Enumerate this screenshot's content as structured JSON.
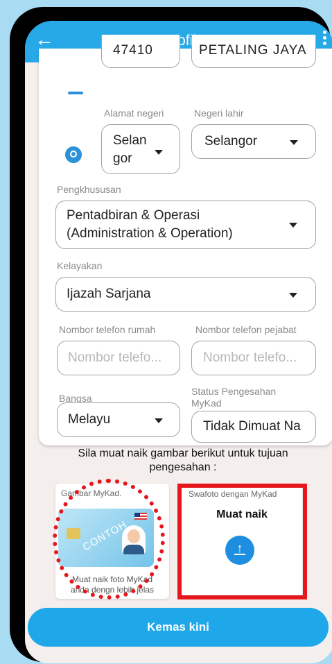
{
  "appbar": {
    "title": "Profil"
  },
  "fields": {
    "poskod_value": "47410",
    "bandar_value": "PETALING JAYA",
    "alamat_negeri_label": "Alamat negeri",
    "alamat_negeri_value_line1": "Selan",
    "alamat_negeri_value_line2": "gor",
    "negeri_lahir_label": "Negeri lahir",
    "negeri_lahir_value": "Selangor",
    "pengkhususan_label": "Pengkhususan",
    "pengkhususan_value_line1": "Pentadbiran & Operasi",
    "pengkhususan_value_line2": "(Administration & Operation)",
    "kelayakan_label": "Kelayakan",
    "kelayakan_value": "Ijazah Sarjana",
    "tel_rumah_label": "Nombor telefon rumah",
    "tel_rumah_placeholder": "Nombor telefo...",
    "tel_pejabat_label": "Nombor telefon pejabat",
    "tel_pejabat_placeholder": "Nombor telefo...",
    "bangsa_label": "Bangsa",
    "bangsa_value": "Melayu",
    "status_label_line1": "Status Pengesahan",
    "status_label_line2": "MyKad",
    "status_value": "Tidak Dimuat Na"
  },
  "upload": {
    "notice_line1": "Sila muat naik gambar berikut untuk tujuan",
    "notice_line2": "pengesahan :",
    "mykad_label": "Gambar MyKad.",
    "mykad_caption_line1": "Muat naik foto MyKad",
    "mykad_caption_line2": "anda dengn lebih jelas",
    "mykad_watermark": "CONTOH",
    "selfie_label": "Swafoto dengan MyKad",
    "selfie_title": "Muat naik"
  },
  "actions": {
    "update_label": "Kemas kini"
  }
}
